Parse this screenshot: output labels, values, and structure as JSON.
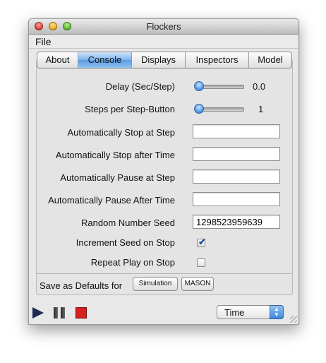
{
  "window": {
    "title": "Flockers"
  },
  "menu": {
    "file": "File"
  },
  "tabs": [
    {
      "label": "About",
      "active": false
    },
    {
      "label": "Console",
      "active": true
    },
    {
      "label": "Displays",
      "active": false
    },
    {
      "label": "Inspectors",
      "active": false
    },
    {
      "label": "Model",
      "active": false
    }
  ],
  "console": {
    "delay": {
      "label": "Delay (Sec/Step)",
      "value": "0.0"
    },
    "steps": {
      "label": "Steps per Step-Button",
      "value": "1"
    },
    "stop_step": {
      "label": "Automatically Stop at Step",
      "value": ""
    },
    "stop_time": {
      "label": "Automatically Stop after Time",
      "value": ""
    },
    "pause_step": {
      "label": "Automatically Pause at Step",
      "value": ""
    },
    "pause_time": {
      "label": "Automatically Pause After Time",
      "value": ""
    },
    "seed": {
      "label": "Random Number Seed",
      "value": "1298523959639"
    },
    "increment_seed": {
      "label": "Increment Seed on Stop",
      "checked": true
    },
    "repeat_play": {
      "label": "Repeat Play on Stop",
      "checked": false
    },
    "defaults": {
      "label": "Save as Defaults for",
      "simulation_button": "Simulation",
      "mason_button": "MASON"
    }
  },
  "controls": {
    "time_select": "Time",
    "colors": {
      "stop": "#d42020",
      "play": "#1e2a55"
    }
  }
}
